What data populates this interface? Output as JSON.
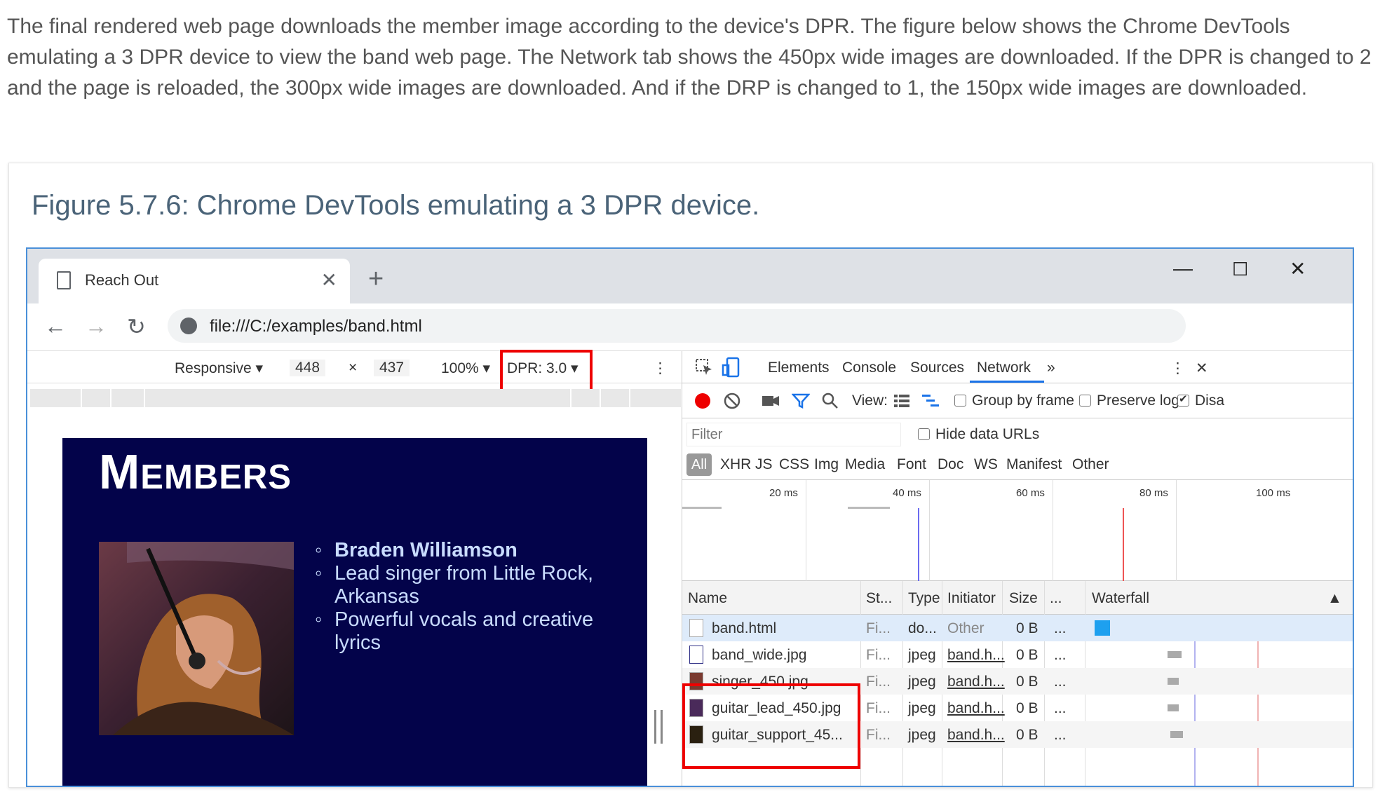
{
  "intro_text": "The final rendered web page downloads the member image according to the device's DPR. The figure below shows the Chrome DevTools emulating a 3 DPR device to view the band web page. The Network tab shows the 450px wide images are downloaded. If the DPR is changed to 2 and the page is reloaded, the 300px wide images are downloaded. And if the DRP is changed to 1, the 150px wide images are downloaded.",
  "figure_caption": "Figure 5.7.6: Chrome DevTools emulating a 3 DPR device.",
  "browser": {
    "tab_title": "Reach Out",
    "tab_close": "✕",
    "new_tab": "+",
    "minimize": "—",
    "maximize": "☐",
    "close": "✕",
    "back": "←",
    "forward": "→",
    "reload": "↻",
    "url": "file:///C:/examples/band.html"
  },
  "device_bar": {
    "mode": "Responsive ▾",
    "width": "448",
    "times": "×",
    "height": "437",
    "zoom": "100% ▾",
    "dpr": "DPR: 3.0 ▾",
    "more": "⋮"
  },
  "page": {
    "heading": "Members",
    "members": [
      "Braden Williamson",
      "Lead singer from Little Rock, Arkansas",
      "Powerful vocals and creative lyrics"
    ]
  },
  "devtools": {
    "tabs": [
      "Elements",
      "Console",
      "Sources",
      "Network"
    ],
    "more_tabs": "»",
    "kebab": "⋮",
    "close": "✕",
    "view_label": "View:",
    "group_by_frame": "Group by frame",
    "preserve_log": "Preserve log",
    "disable_cache": "Disa",
    "filter_placeholder": "Filter",
    "hide_data_urls": "Hide data URLs",
    "type_filters": [
      "All",
      "XHR",
      "JS",
      "CSS",
      "Img",
      "Media",
      "Font",
      "Doc",
      "WS",
      "Manifest",
      "Other"
    ],
    "timeline_ticks": [
      "20 ms",
      "40 ms",
      "60 ms",
      "80 ms",
      "100 ms"
    ],
    "columns": [
      "Name",
      "St...",
      "Type",
      "Initiator",
      "Size",
      "...",
      "Waterfall"
    ],
    "sort_arrow": "▲",
    "requests": [
      {
        "name": "band.html",
        "status": "Fi...",
        "type": "do...",
        "initiator": "Other",
        "size": "0 B",
        "more": "..."
      },
      {
        "name": "band_wide.jpg",
        "status": "Fi...",
        "type": "jpeg",
        "initiator": "band.h...",
        "size": "0 B",
        "more": "..."
      },
      {
        "name": "singer_450.jpg",
        "status": "Fi...",
        "type": "jpeg",
        "initiator": "band.h...",
        "size": "0 B",
        "more": "..."
      },
      {
        "name": "guitar_lead_450.jpg",
        "status": "Fi...",
        "type": "jpeg",
        "initiator": "band.h...",
        "size": "0 B",
        "more": "..."
      },
      {
        "name": "guitar_support_45...",
        "status": "Fi...",
        "type": "jpeg",
        "initiator": "band.h...",
        "size": "0 B",
        "more": "..."
      }
    ]
  },
  "colors": {
    "highlight": "#e00000",
    "page_bg": "#03034a",
    "member_text": "#c9dcff",
    "accent": "#1a73e8"
  }
}
